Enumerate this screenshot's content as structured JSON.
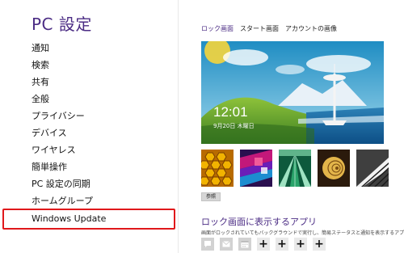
{
  "left_pane": {
    "title": "PC 設定",
    "items": [
      {
        "label": "通知"
      },
      {
        "label": "検索"
      },
      {
        "label": "共有"
      },
      {
        "label": "全般"
      },
      {
        "label": "プライバシー"
      },
      {
        "label": "デバイス"
      },
      {
        "label": "ワイヤレス"
      },
      {
        "label": "簡単操作"
      },
      {
        "label": "PC 設定の同期"
      },
      {
        "label": "ホームグループ"
      },
      {
        "label": "Windows Update"
      }
    ],
    "selected_item": "Windows Update"
  },
  "tabs": [
    {
      "label": "ロック画面",
      "active": true
    },
    {
      "label": "スタート画面",
      "active": false
    },
    {
      "label": "アカウントの画像",
      "active": false
    }
  ],
  "lock_screen": {
    "time": "12:01",
    "date": "9月20日 木曜日"
  },
  "thumbnails": [
    {
      "name": "honeycomb-thumbnail"
    },
    {
      "name": "colorful-cubes-thumbnail"
    },
    {
      "name": "road-lanes-thumbnail"
    },
    {
      "name": "nautilus-shell-thumbnail"
    },
    {
      "name": "piano-keys-thumbnail"
    }
  ],
  "browse_button": "参照",
  "lock_apps": {
    "heading": "ロック画面に表示するアプリ",
    "description": "画面がロックされていてもバックグラウンドで実行し、簡易ステータスと通知を表示するアプリを選ぶ",
    "slots": [
      {
        "type": "app",
        "icon": "chat-icon"
      },
      {
        "type": "app",
        "icon": "mail-icon"
      },
      {
        "type": "app",
        "icon": "calendar-icon"
      },
      {
        "type": "add",
        "symbol": "+"
      },
      {
        "type": "add",
        "symbol": "+"
      },
      {
        "type": "add",
        "symbol": "+"
      },
      {
        "type": "add",
        "symbol": "+"
      }
    ]
  },
  "colors": {
    "accent": "#4b2c84",
    "highlight_border": "#e0181b"
  }
}
